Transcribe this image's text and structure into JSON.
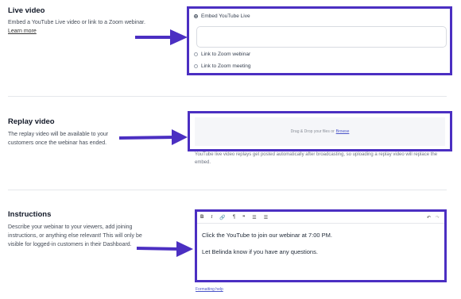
{
  "live": {
    "title": "Live video",
    "description": "Embed a YouTube Live video or link to a Zoom webinar.",
    "learn_more": "Learn more",
    "options": [
      "Embed YouTube Live",
      "Link to Zoom webinar",
      "Link to Zoom meeting"
    ],
    "selected_option": "Embed YouTube Live",
    "embed_value": ""
  },
  "replay": {
    "title": "Replay video",
    "description": "The replay video will be available to your customers once the webinar has ended.",
    "drop_text": "Drag & Drop your files or",
    "browse": "Browse",
    "hint": "YouTube live video replays get posted automatically after broadcasting, so uploading a replay video will replace the embed."
  },
  "instructions": {
    "title": "Instructions",
    "description": "Describe your webinar to your viewers, add joining instructions, or anything else relevant! This will only be visible for logged-in customers in their Dashboard.",
    "toolbar": {
      "bold": "B",
      "italic": "I",
      "link": "🔗",
      "heading": "¶",
      "quote": "❞",
      "bullets": "☰",
      "numbers": "☰",
      "undo": "↶",
      "redo": "↷"
    },
    "line1": "Click the YouTube to join our webinar at 7:00 PM.",
    "line2": "Let Belinda know if you have any questions.",
    "formatting_help": "Formatting help"
  },
  "colors": {
    "highlight": "#4b2fc2",
    "link": "#4b55c9"
  },
  "icons": [
    "arrow-right-icon",
    "bold-icon",
    "italic-icon",
    "link-icon",
    "heading-icon",
    "quote-icon",
    "bullet-list-icon",
    "numbered-list-icon",
    "undo-icon",
    "redo-icon"
  ]
}
